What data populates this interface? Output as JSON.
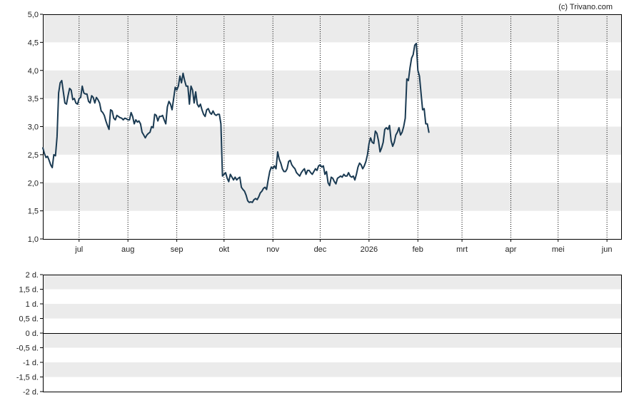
{
  "copyright": "(c) Trivano.com",
  "colors": {
    "line": "#1a3a52",
    "band": "#ebebeb",
    "frame": "#000000",
    "grid": "#000000",
    "text": "#222222"
  },
  "chart_data": [
    {
      "type": "line",
      "title": "",
      "xlabel": "",
      "ylabel": "",
      "ylim": [
        1.0,
        5.0
      ],
      "yticks": [
        "5,0",
        "4,5",
        "4,0",
        "3,5",
        "3,0",
        "2,5",
        "2,0",
        "1,5",
        "1,0"
      ],
      "ytick_values": [
        5.0,
        4.5,
        4.0,
        3.5,
        3.0,
        2.5,
        2.0,
        1.5,
        1.0
      ],
      "xticks": [
        "jul",
        "aug",
        "sep",
        "okt",
        "nov",
        "dec",
        "2026",
        "feb",
        "mrt",
        "apr",
        "mei",
        "jun"
      ],
      "xtick_days": [
        23,
        54,
        85,
        115,
        146,
        176,
        207,
        238,
        266,
        297,
        327,
        358
      ],
      "x_domain_days": [
        0,
        367
      ],
      "grid": "vertical dotted at month starts, alternating horizontal bands",
      "series": [
        {
          "values": [
            [
              0,
              2.62
            ],
            [
              1,
              2.52
            ],
            [
              2,
              2.45
            ],
            [
              3,
              2.47
            ],
            [
              4,
              2.4
            ],
            [
              5,
              2.32
            ],
            [
              6,
              2.27
            ],
            [
              7,
              2.5
            ],
            [
              8,
              2.48
            ],
            [
              9,
              2.82
            ],
            [
              10,
              3.6
            ],
            [
              11,
              3.78
            ],
            [
              12,
              3.82
            ],
            [
              13,
              3.62
            ],
            [
              14,
              3.42
            ],
            [
              15,
              3.4
            ],
            [
              16,
              3.55
            ],
            [
              17,
              3.68
            ],
            [
              18,
              3.65
            ],
            [
              19,
              3.48
            ],
            [
              20,
              3.5
            ],
            [
              21,
              3.42
            ],
            [
              22,
              3.4
            ],
            [
              23,
              3.5
            ],
            [
              24,
              3.52
            ],
            [
              25,
              3.72
            ],
            [
              26,
              3.6
            ],
            [
              27,
              3.58
            ],
            [
              28,
              3.58
            ],
            [
              29,
              3.45
            ],
            [
              30,
              3.42
            ],
            [
              31,
              3.55
            ],
            [
              32,
              3.52
            ],
            [
              33,
              3.42
            ],
            [
              34,
              3.52
            ],
            [
              35,
              3.48
            ],
            [
              36,
              3.42
            ],
            [
              37,
              3.28
            ],
            [
              38,
              3.25
            ],
            [
              39,
              3.2
            ],
            [
              40,
              3.1
            ],
            [
              41,
              3.02
            ],
            [
              42,
              2.95
            ],
            [
              43,
              3.3
            ],
            [
              44,
              3.28
            ],
            [
              45,
              3.15
            ],
            [
              46,
              3.12
            ],
            [
              47,
              3.2
            ],
            [
              48,
              3.18
            ],
            [
              49,
              3.16
            ],
            [
              50,
              3.15
            ],
            [
              51,
              3.12
            ],
            [
              52,
              3.15
            ],
            [
              53,
              3.14
            ],
            [
              54,
              3.12
            ],
            [
              55,
              3.12
            ],
            [
              56,
              3.25
            ],
            [
              57,
              3.18
            ],
            [
              58,
              3.05
            ],
            [
              59,
              3.12
            ],
            [
              60,
              3.08
            ],
            [
              61,
              3.1
            ],
            [
              62,
              3.05
            ],
            [
              63,
              2.9
            ],
            [
              64,
              2.85
            ],
            [
              65,
              2.8
            ],
            [
              66,
              2.85
            ],
            [
              67,
              2.88
            ],
            [
              68,
              2.9
            ],
            [
              69,
              3.0
            ],
            [
              70,
              2.98
            ],
            [
              71,
              3.22
            ],
            [
              72,
              3.2
            ],
            [
              73,
              3.1
            ],
            [
              74,
              3.18
            ],
            [
              75,
              3.18
            ],
            [
              76,
              3.2
            ],
            [
              77,
              3.12
            ],
            [
              78,
              3.05
            ],
            [
              79,
              3.35
            ],
            [
              80,
              3.45
            ],
            [
              81,
              3.4
            ],
            [
              82,
              3.3
            ],
            [
              83,
              3.5
            ],
            [
              84,
              3.7
            ],
            [
              85,
              3.65
            ],
            [
              86,
              3.72
            ],
            [
              87,
              3.9
            ],
            [
              88,
              3.78
            ],
            [
              89,
              3.95
            ],
            [
              90,
              3.82
            ],
            [
              91,
              3.72
            ],
            [
              92,
              3.72
            ],
            [
              93,
              3.4
            ],
            [
              94,
              3.72
            ],
            [
              95,
              3.65
            ],
            [
              96,
              3.42
            ],
            [
              97,
              3.62
            ],
            [
              98,
              3.4
            ],
            [
              99,
              3.35
            ],
            [
              100,
              3.4
            ],
            [
              101,
              3.3
            ],
            [
              102,
              3.22
            ],
            [
              103,
              3.18
            ],
            [
              104,
              3.3
            ],
            [
              105,
              3.32
            ],
            [
              106,
              3.25
            ],
            [
              107,
              3.22
            ],
            [
              108,
              3.28
            ],
            [
              109,
              3.22
            ],
            [
              110,
              3.2
            ],
            [
              111,
              3.22
            ],
            [
              112,
              3.22
            ],
            [
              113,
              3.05
            ],
            [
              114,
              2.12
            ],
            [
              115,
              2.15
            ],
            [
              116,
              2.18
            ],
            [
              117,
              2.08
            ],
            [
              118,
              2.02
            ],
            [
              119,
              2.15
            ],
            [
              120,
              2.1
            ],
            [
              121,
              2.05
            ],
            [
              122,
              2.1
            ],
            [
              123,
              2.05
            ],
            [
              124,
              2.08
            ],
            [
              125,
              2.1
            ],
            [
              126,
              1.92
            ],
            [
              127,
              1.88
            ],
            [
              128,
              1.85
            ],
            [
              129,
              1.78
            ],
            [
              130,
              1.68
            ],
            [
              131,
              1.65
            ],
            [
              132,
              1.66
            ],
            [
              133,
              1.65
            ],
            [
              134,
              1.7
            ],
            [
              135,
              1.72
            ],
            [
              136,
              1.7
            ],
            [
              137,
              1.75
            ],
            [
              138,
              1.82
            ],
            [
              139,
              1.85
            ],
            [
              140,
              1.9
            ],
            [
              141,
              1.92
            ],
            [
              142,
              1.88
            ],
            [
              143,
              2.05
            ],
            [
              144,
              2.2
            ],
            [
              145,
              2.28
            ],
            [
              146,
              2.25
            ],
            [
              147,
              2.3
            ],
            [
              148,
              2.25
            ],
            [
              149,
              2.55
            ],
            [
              150,
              2.42
            ],
            [
              151,
              2.35
            ],
            [
              152,
              2.25
            ],
            [
              153,
              2.2
            ],
            [
              154,
              2.2
            ],
            [
              155,
              2.25
            ],
            [
              156,
              2.38
            ],
            [
              157,
              2.4
            ],
            [
              158,
              2.32
            ],
            [
              159,
              2.28
            ],
            [
              160,
              2.25
            ],
            [
              161,
              2.18
            ],
            [
              162,
              2.15
            ],
            [
              163,
              2.12
            ],
            [
              164,
              2.18
            ],
            [
              165,
              2.22
            ],
            [
              166,
              2.25
            ],
            [
              167,
              2.15
            ],
            [
              168,
              2.22
            ],
            [
              169,
              2.22
            ],
            [
              170,
              2.18
            ],
            [
              171,
              2.15
            ],
            [
              172,
              2.2
            ],
            [
              173,
              2.25
            ],
            [
              174,
              2.22
            ],
            [
              175,
              2.3
            ],
            [
              176,
              2.32
            ],
            [
              177,
              2.28
            ],
            [
              178,
              2.3
            ],
            [
              179,
              2.15
            ],
            [
              180,
              2.2
            ],
            [
              181,
              2.0
            ],
            [
              182,
              1.95
            ],
            [
              183,
              2.1
            ],
            [
              184,
              2.08
            ],
            [
              185,
              2.02
            ],
            [
              186,
              1.98
            ],
            [
              187,
              2.08
            ],
            [
              188,
              2.1
            ],
            [
              189,
              2.12
            ],
            [
              190,
              2.1
            ],
            [
              191,
              2.15
            ],
            [
              192,
              2.12
            ],
            [
              193,
              2.12
            ],
            [
              194,
              2.18
            ],
            [
              195,
              2.12
            ],
            [
              196,
              2.1
            ],
            [
              197,
              2.12
            ],
            [
              198,
              2.05
            ],
            [
              199,
              2.15
            ],
            [
              200,
              2.28
            ],
            [
              201,
              2.35
            ],
            [
              202,
              2.32
            ],
            [
              203,
              2.25
            ],
            [
              204,
              2.3
            ],
            [
              205,
              2.38
            ],
            [
              206,
              2.5
            ],
            [
              207,
              2.7
            ],
            [
              208,
              2.8
            ],
            [
              209,
              2.72
            ],
            [
              210,
              2.7
            ],
            [
              211,
              2.92
            ],
            [
              212,
              2.88
            ],
            [
              213,
              2.75
            ],
            [
              214,
              2.55
            ],
            [
              215,
              2.62
            ],
            [
              216,
              2.72
            ],
            [
              217,
              2.95
            ],
            [
              218,
              2.98
            ],
            [
              219,
              2.95
            ],
            [
              220,
              3.02
            ],
            [
              221,
              2.75
            ],
            [
              222,
              2.65
            ],
            [
              223,
              2.72
            ],
            [
              224,
              2.85
            ],
            [
              225,
              2.9
            ],
            [
              226,
              2.98
            ],
            [
              227,
              2.85
            ],
            [
              228,
              2.9
            ],
            [
              229,
              3.0
            ],
            [
              230,
              3.15
            ],
            [
              231,
              3.85
            ],
            [
              232,
              3.82
            ],
            [
              233,
              4.05
            ],
            [
              234,
              4.22
            ],
            [
              235,
              4.28
            ],
            [
              236,
              4.45
            ],
            [
              237,
              4.48
            ],
            [
              238,
              4.0
            ],
            [
              239,
              3.9
            ],
            [
              240,
              3.6
            ],
            [
              241,
              3.3
            ],
            [
              242,
              3.32
            ],
            [
              243,
              3.05
            ],
            [
              244,
              3.05
            ],
            [
              245,
              2.9
            ]
          ]
        }
      ]
    },
    {
      "type": "line",
      "title": "",
      "xlabel": "",
      "ylabel": "",
      "ylim": [
        -2,
        2
      ],
      "yticks": [
        "2 d.",
        "1,5 d.",
        "1 d.",
        "0,5 d.",
        "0 d.",
        "-0,5 d.",
        "-1 d.",
        "-1,5 d.",
        "-2 d."
      ],
      "ytick_values": [
        2,
        1.5,
        1,
        0.5,
        0,
        -0.5,
        -1,
        -1.5,
        -2
      ],
      "zero_line": 0,
      "grid": "alternating horizontal bands",
      "series": []
    }
  ]
}
